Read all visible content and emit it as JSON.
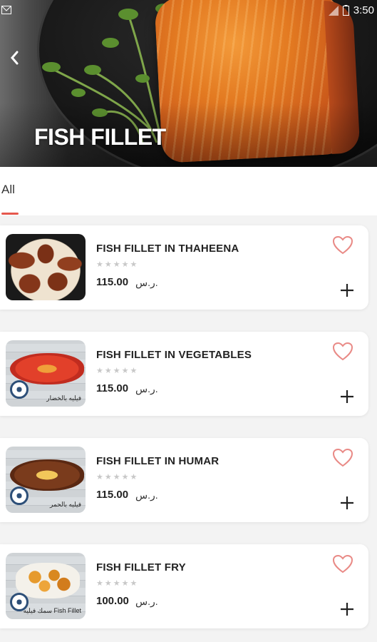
{
  "status_bar": {
    "time": "3:50"
  },
  "header": {
    "title": "FISH FILLET"
  },
  "tabs": [
    {
      "label": "All",
      "active": true
    }
  ],
  "colors": {
    "accent": "#e5584d",
    "heart": "#e98a86"
  },
  "rating_glyphs": "★★★★★",
  "items": [
    {
      "name": "FISH FILLET IN THAHEENA",
      "price": "115.00",
      "currency": "ر.س.",
      "rating": 0,
      "image_text": ""
    },
    {
      "name": "FISH FILLET IN VEGETABLES",
      "price": "115.00",
      "currency": "ر.س.",
      "rating": 0,
      "image_text": "فيليه بالخضار"
    },
    {
      "name": "FISH FILLET IN HUMAR",
      "price": "115.00",
      "currency": "ر.س.",
      "rating": 0,
      "image_text": "فيليه بالحمر"
    },
    {
      "name": "FISH FILLET FRY",
      "price": "100.00",
      "currency": "ر.س.",
      "rating": 0,
      "image_text": "سمك فيليه Fish Fillet"
    }
  ]
}
